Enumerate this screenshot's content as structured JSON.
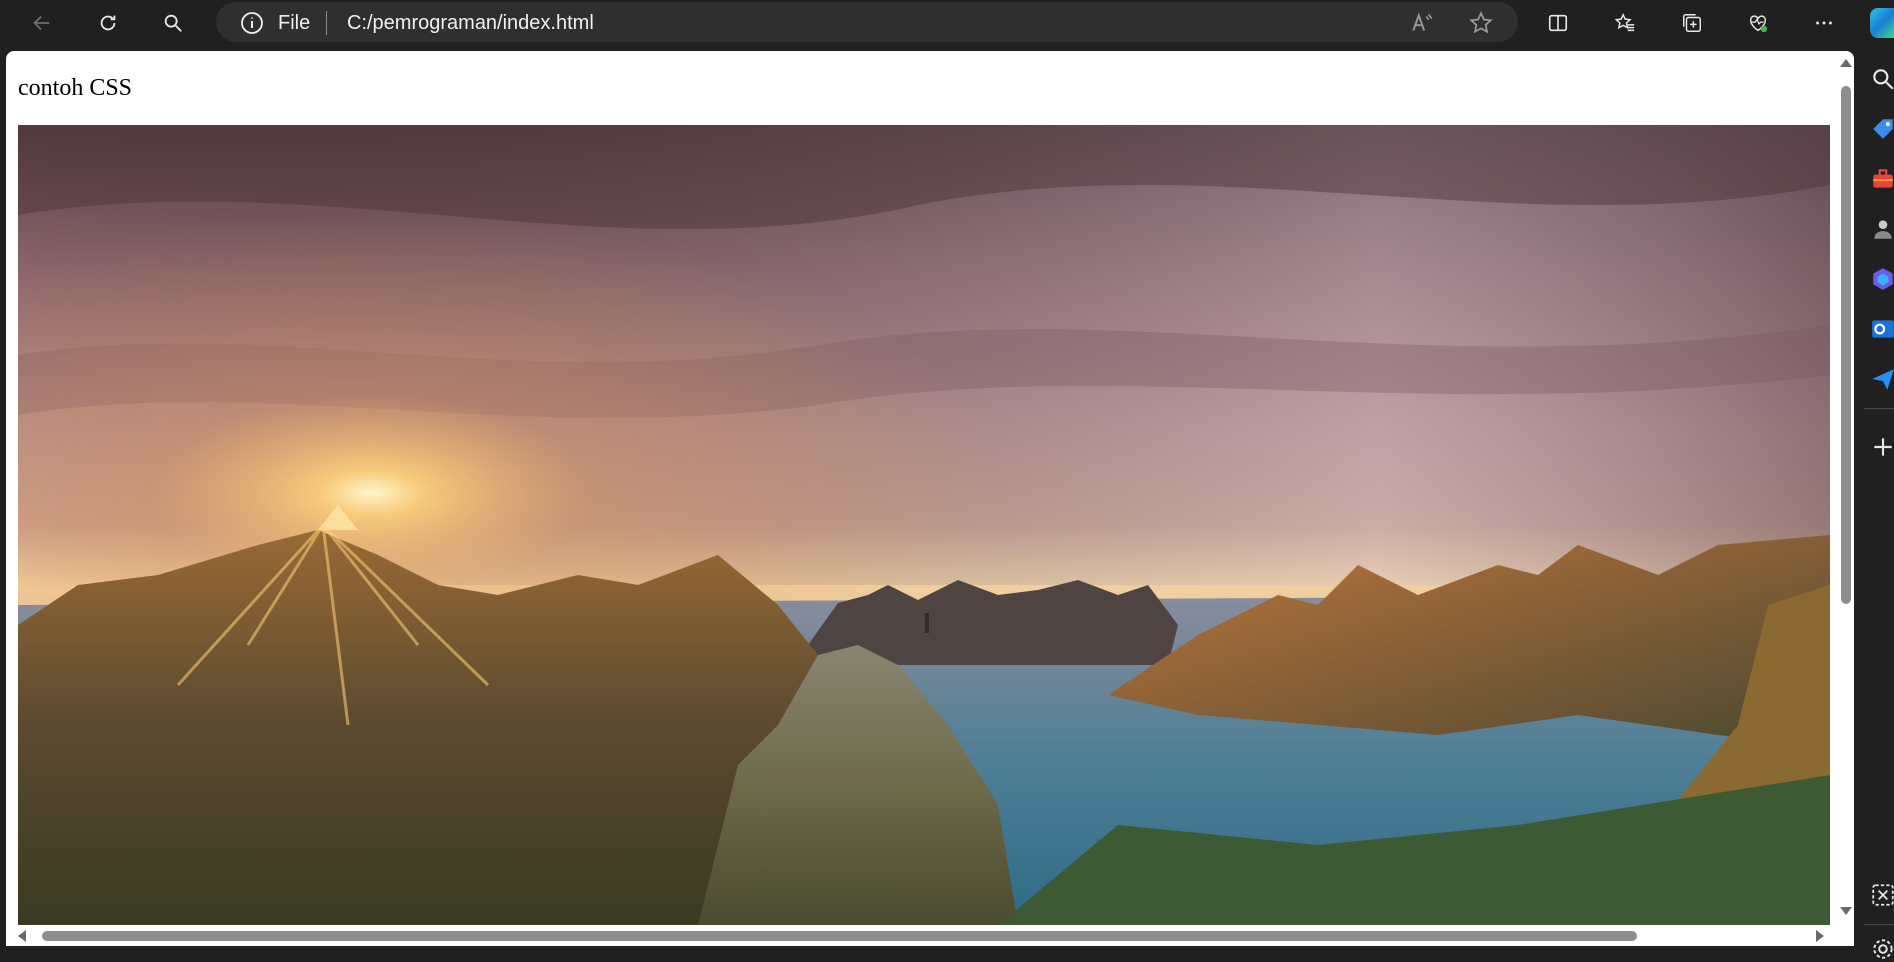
{
  "toolbar": {
    "back_icon": "back-arrow-icon",
    "refresh_icon": "refresh-icon",
    "search_icon": "search-icon"
  },
  "address_bar": {
    "info_icon": "info-icon",
    "scheme_label": "File",
    "url": "C:/pemrograman/index.html",
    "read_aloud_icon": "read-aloud-icon",
    "favorite_icon": "star-icon"
  },
  "browser_actions": [
    "split-screen-icon",
    "favorites-icon",
    "collections-icon",
    "browser-essentials-icon",
    "more-icon"
  ],
  "page": {
    "heading": "contoh CSS",
    "image_description": "mountain-fjord-sunset-photo"
  },
  "sidebar": [
    "search-icon",
    "shopping-tag-icon",
    "tools-icon",
    "people-icon",
    "copilot-icon",
    "outlook-icon",
    "send-icon",
    "add-icon",
    "screenshot-icon",
    "settings-icon"
  ],
  "colors": {
    "chrome_bg": "#202020",
    "address_bg": "#2f2f2f",
    "page_bg": "#ffffff"
  }
}
